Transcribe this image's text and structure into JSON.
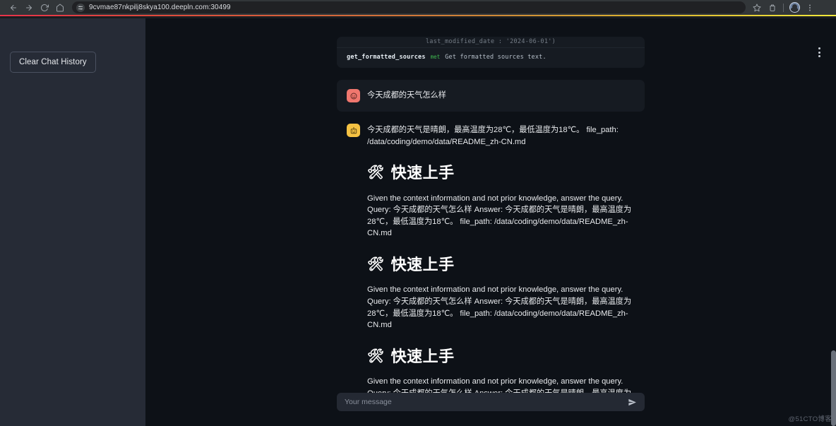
{
  "browser": {
    "back_icon": "back-arrow-icon",
    "forward_icon": "forward-arrow-icon",
    "reload_icon": "reload-icon",
    "home_icon": "home-icon",
    "site_info_icon": "site-settings-icon",
    "url": "9cvmae87nkpilj8skya100.deepln.com:30499",
    "bookmark_icon": "star-icon",
    "extensions_icon": "extensions-icon",
    "profile_icon": "profile-avatar-icon",
    "menu_icon": "chrome-menu-icon",
    "accent_start": "#e8334a",
    "accent_end": "#f2e93b"
  },
  "sidebar": {
    "clear_chat_label": "Clear Chat History"
  },
  "content": {
    "kebab_icon": "more-options-icon"
  },
  "code_block": {
    "top_line": "last_modified_date : '2024-06-01')",
    "function_name": "get_formatted_sources",
    "keyword": "met",
    "description": "Get formatted sources text."
  },
  "messages": [
    {
      "role": "user",
      "avatar_icon": "user-face-avatar",
      "text": "今天成都的天气怎么样"
    },
    {
      "role": "assistant",
      "avatar_icon": "robot-avatar",
      "text": "今天成都的天气是晴朗，最高温度为28℃，最低温度为18℃。 file_path: /data/coding/demo/data/README_zh-CN.md",
      "blocks": [
        {
          "type": "heading",
          "emoji": "🛠",
          "text": "快速上手"
        },
        {
          "type": "paragraph",
          "text": "Given the context information and not prior knowledge, answer the query. Query: 今天成都的天气怎么样 Answer: 今天成都的天气是晴朗，最高温度为28℃，最低温度为18℃。 file_path: /data/coding/demo/data/README_zh-CN.md"
        },
        {
          "type": "heading",
          "emoji": "🛠",
          "text": "快速上手"
        },
        {
          "type": "paragraph",
          "text": "Given the context information and not prior knowledge, answer the query. Query: 今天成都的天气怎么样 Answer: 今天成都的天气是晴朗，最高温度为28℃，最低温度为18℃。 file_path: /data/coding/demo/data/README_zh-CN.md"
        },
        {
          "type": "heading",
          "emoji": "🛠",
          "text": "快速上手"
        },
        {
          "type": "paragraph",
          "text": "Given the context information and not prior knowledge, answer the query. Query: 今天成都的天气怎么样 Answer: 今天成都的天气是晴朗，最高温度为28℃，最低温度为18℃。 file_path: /data/coding/demo/data/README_zh"
        }
      ]
    }
  ],
  "composer": {
    "placeholder": "Your message",
    "value": "",
    "send_icon": "send-paper-plane-icon"
  },
  "watermark": "@51CTO博客"
}
